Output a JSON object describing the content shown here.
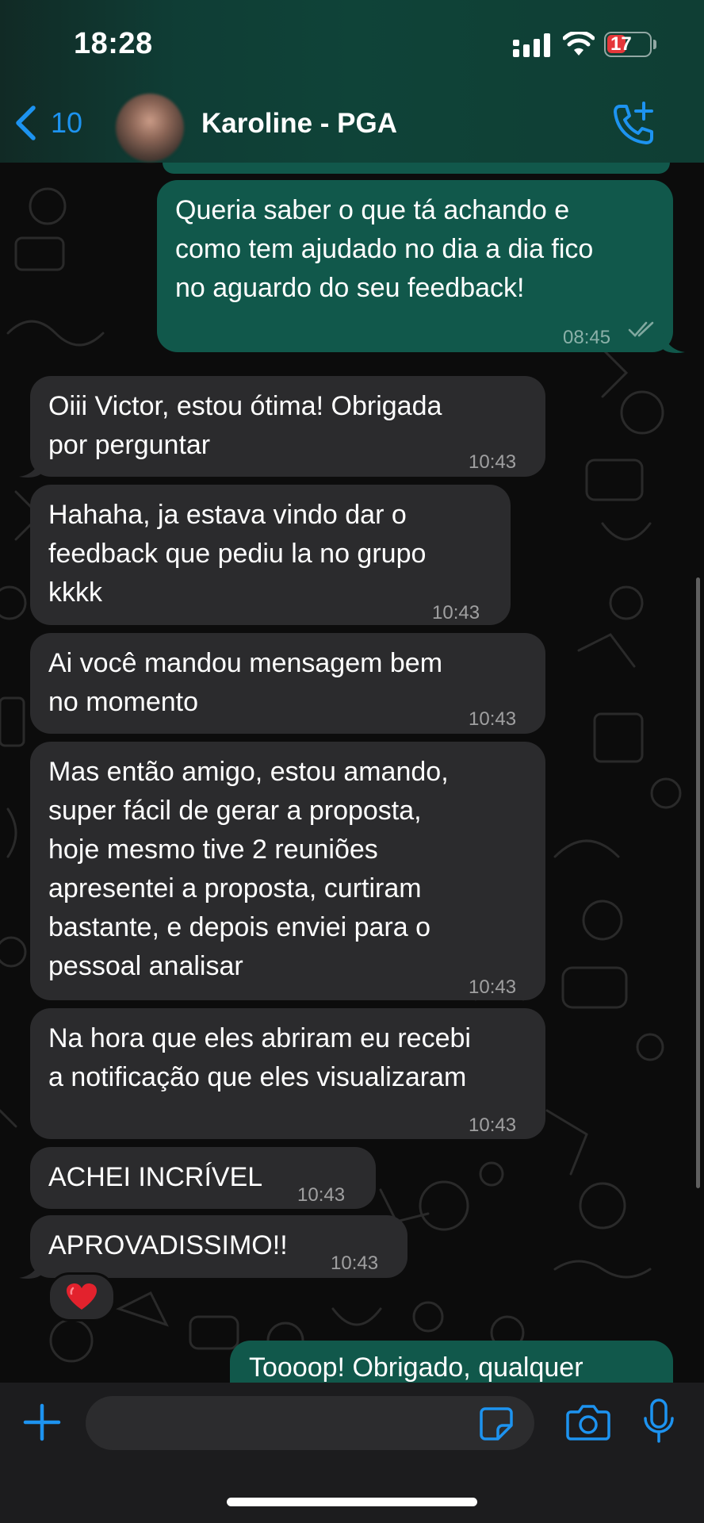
{
  "status_bar": {
    "time": "18:28",
    "battery": "17"
  },
  "header": {
    "back_count": "10",
    "contact_name": "Karoline - PGA"
  },
  "messages": [
    {
      "direction": "out",
      "text": "Queria saber o que tá achando e\ncomo tem ajudado no dia a dia fico\nno aguardo do seu feedback!",
      "time": "08:45"
    },
    {
      "direction": "in",
      "text": "Oiii Victor, estou ótima! Obrigada\npor perguntar",
      "time": "10:43"
    },
    {
      "direction": "in",
      "text": "Hahaha, ja estava vindo dar o\nfeedback que pediu la no grupo\nkkkk",
      "time": "10:43"
    },
    {
      "direction": "in",
      "text": "Ai você mandou mensagem bem\nno momento",
      "time": "10:43"
    },
    {
      "direction": "in",
      "text": "Mas então amigo, estou amando,\nsuper fácil de gerar a proposta,\nhoje mesmo tive 2 reuniões\napresentei a proposta, curtiram\nbastante, e depois enviei para o\npessoal analisar",
      "time": "10:43"
    },
    {
      "direction": "in",
      "text": "Na hora que eles abriram eu recebi\na notificação que eles visualizaram",
      "time": "10:43"
    },
    {
      "direction": "in",
      "text": "ACHEI INCRÍVEL",
      "time": "10:43"
    },
    {
      "direction": "in",
      "text": "APROVADISSIMO!!",
      "time": "10:43",
      "reaction": "❤️"
    },
    {
      "direction": "out",
      "text": "Toooop! Obrigado, qualquer",
      "time": ""
    }
  ],
  "composer": {
    "placeholder": ""
  },
  "colors": {
    "accent": "#1d93f0",
    "outgoing_bubble": "#11584b",
    "incoming_bubble": "#2b2b2d"
  }
}
